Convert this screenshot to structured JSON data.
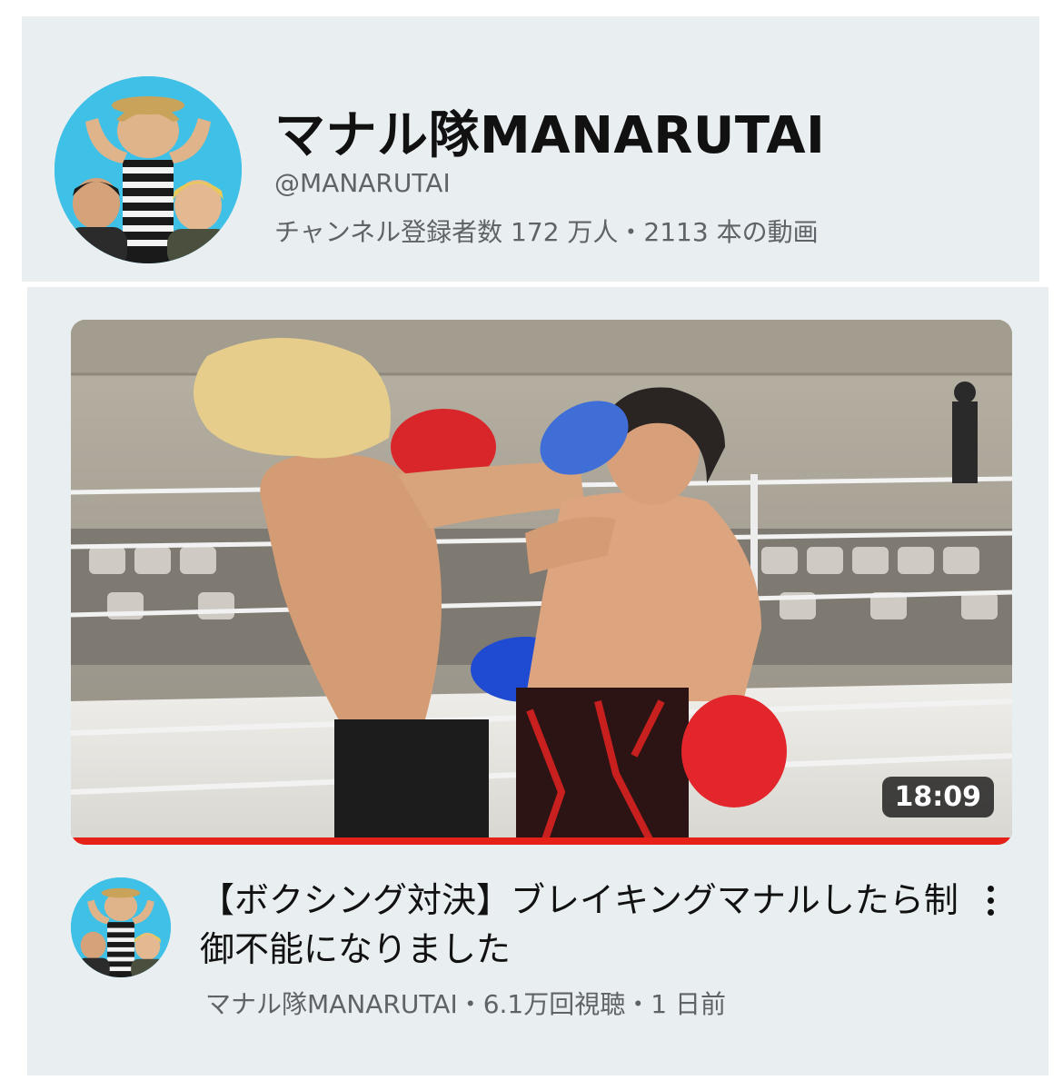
{
  "channel": {
    "name": "マナル隊MANARUTAI",
    "handle": "@MANARUTAI",
    "meta": "チャンネル登録者数 172 万人・2113 本の動画",
    "avatar_icon": "channel-avatar-icon"
  },
  "video": {
    "duration": "18:09",
    "watch_progress": 1.0,
    "title": "【ボクシング対決】ブレイキングマナルしたら制御不能になりました",
    "meta": "マナル隊MANARUTAI・6.1万回視聴・1 日前",
    "more_icon": "more-vertical-icon"
  },
  "colors": {
    "card_background": "#e9eef1",
    "progress_red": "#e62117",
    "avatar_blue": "#3fc0e6",
    "primary_text": "#111111",
    "secondary_text": "#5f6368"
  }
}
